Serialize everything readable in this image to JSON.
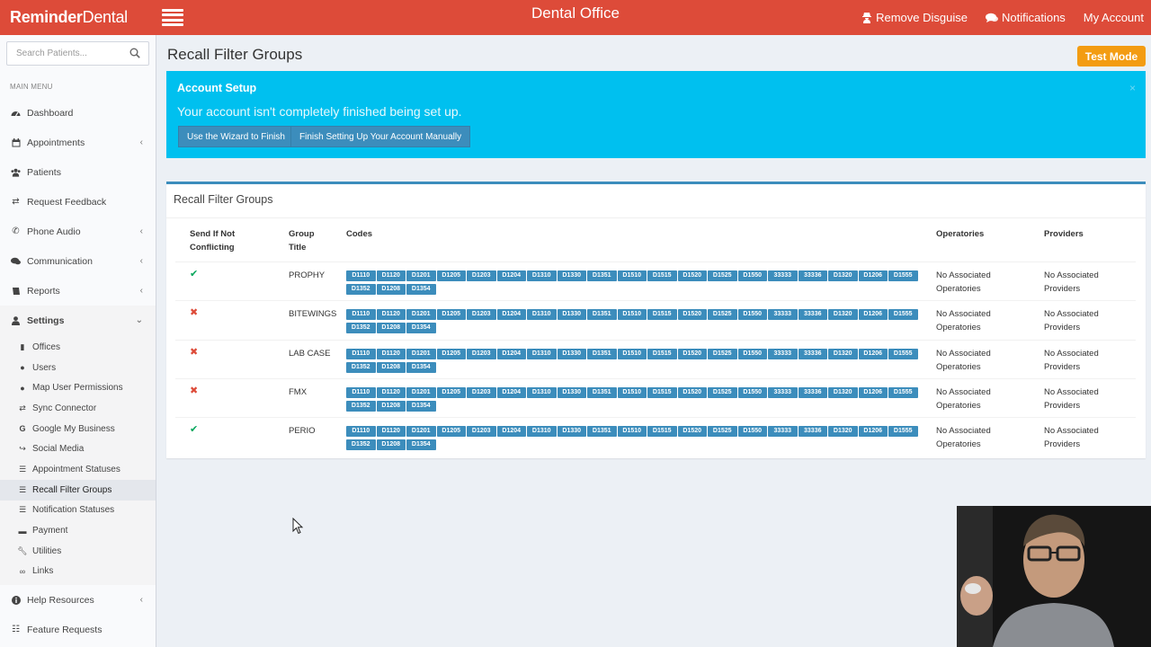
{
  "topbar": {
    "brand_bold": "Reminder",
    "brand_rest": "Dental",
    "center_title": "Dental Office",
    "nav": [
      {
        "icon": "user-secret-icon",
        "label": "Remove Disguise"
      },
      {
        "icon": "comments-icon",
        "label": "Notifications"
      },
      {
        "icon": "",
        "label": "My Account"
      }
    ]
  },
  "sidebar": {
    "search_placeholder": "Search Patients...",
    "menu_header": "MAIN MENU",
    "items": [
      {
        "label": "Dashboard",
        "icon": "dashboard-icon"
      },
      {
        "label": "Appointments",
        "icon": "calendar-icon"
      },
      {
        "label": "Patients",
        "icon": "users-icon"
      },
      {
        "label": "Request Feedback",
        "icon": "retweet-icon"
      },
      {
        "label": "Phone Audio",
        "icon": "phone-icon"
      },
      {
        "label": "Communication",
        "icon": "comments-icon"
      },
      {
        "label": "Reports",
        "icon": "book-icon"
      },
      {
        "label": "Settings",
        "icon": "user-icon"
      }
    ],
    "settings_sub": [
      {
        "label": "Offices",
        "icon": "building-icon"
      },
      {
        "label": "Users",
        "icon": "user-icon"
      },
      {
        "label": "Map User Permissions",
        "icon": "user-icon"
      },
      {
        "label": "Sync Connector",
        "icon": "exchange-icon"
      },
      {
        "label": "Google My Business",
        "icon": "google-icon"
      },
      {
        "label": "Social Media",
        "icon": "share-icon"
      },
      {
        "label": "Appointment Statuses",
        "icon": "list-icon"
      },
      {
        "label": "Recall Filter Groups",
        "icon": "list-alt-icon"
      },
      {
        "label": "Notification Statuses",
        "icon": "list-icon"
      },
      {
        "label": "Payment",
        "icon": "credit-card-icon"
      },
      {
        "label": "Utilities",
        "icon": "wrench-icon"
      },
      {
        "label": "Links",
        "icon": "link-icon"
      }
    ],
    "bottom_items": [
      {
        "label": "Help Resources",
        "icon": "info-circle-icon"
      },
      {
        "label": "Feature Requests",
        "icon": "list-ol-icon"
      }
    ]
  },
  "main": {
    "page_title": "Recall Filter Groups",
    "test_mode": "Test Mode",
    "callout": {
      "title": "Account Setup",
      "message": "Your account isn't completely finished being set up.",
      "close": "×",
      "btn_wizard": "Use the Wizard to Finish",
      "btn_manual": "Finish Setting Up Your Account Manually"
    },
    "box_title": "Recall Filter Groups",
    "table": {
      "headers": {
        "send_line1": "Send If Not",
        "send_line2": "Conflicting",
        "title_line1": "Group",
        "title_line2": "Title",
        "codes": "Codes",
        "operatories": "Operatories",
        "providers": "Providers"
      },
      "codes": [
        "D1110",
        "D1120",
        "D1201",
        "D1205",
        "D1203",
        "D1204",
        "D1310",
        "D1330",
        "D1351",
        "D1510",
        "D1515",
        "D1520",
        "D1525",
        "D1550",
        "33333",
        "33336",
        "D1320",
        "D1206",
        "D1555",
        "D1352",
        "D1208",
        "D1354"
      ],
      "rows": [
        {
          "send": true,
          "title": "PROPHY",
          "op1": "No Associated",
          "op2": "Operatories",
          "pr1": "No Associated",
          "pr2": "Providers"
        },
        {
          "send": false,
          "title": "BITEWINGS",
          "op1": "No Associated",
          "op2": "Operatories",
          "pr1": "No Associated",
          "pr2": "Providers"
        },
        {
          "send": false,
          "title": "LAB CASE",
          "op1": "No Associated",
          "op2": "Operatories",
          "pr1": "No Associated",
          "pr2": "Providers"
        },
        {
          "send": false,
          "title": "FMX",
          "op1": "No Associated",
          "op2": "Operatories",
          "pr1": "No Associated",
          "pr2": "Providers"
        },
        {
          "send": true,
          "title": "PERIO",
          "op1": "No Associated",
          "op2": "Operatories",
          "pr1": "No Associated",
          "pr2": "Providers"
        }
      ],
      "check_glyph": "✔",
      "cross_glyph": "✖"
    }
  },
  "colors": {
    "topbar": "#dd4b39",
    "callout": "#00c0ef",
    "tag": "#3c8dbc",
    "test_mode": "#f39c12",
    "ok": "#00a65a",
    "no": "#dd4b39"
  }
}
